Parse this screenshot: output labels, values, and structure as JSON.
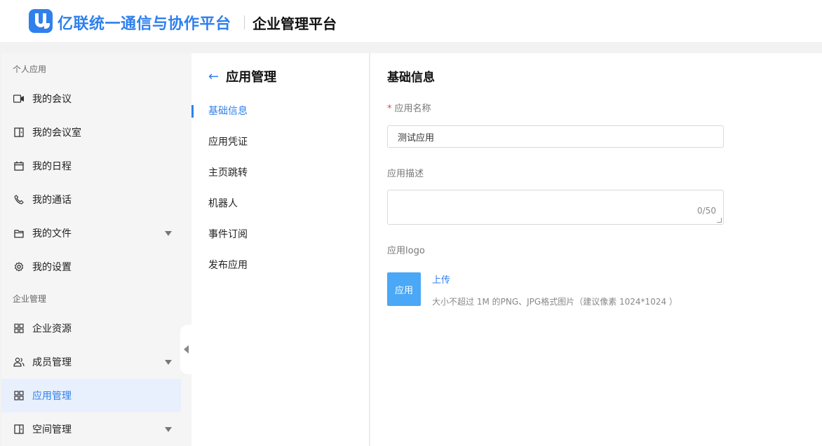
{
  "header": {
    "brand": "亿联统一通信与协作平台",
    "platform": "企业管理平台"
  },
  "sidebar": {
    "group_personal": "个人应用",
    "group_enterprise": "企业管理",
    "items": [
      {
        "label": "我的会议",
        "icon": "video-icon"
      },
      {
        "label": "我的会议室",
        "icon": "door-icon"
      },
      {
        "label": "我的日程",
        "icon": "calendar-icon"
      },
      {
        "label": "我的通话",
        "icon": "phone-icon"
      },
      {
        "label": "我的文件",
        "icon": "folder-icon"
      },
      {
        "label": "我的设置",
        "icon": "gear-icon"
      },
      {
        "label": "企业资源",
        "icon": "grid-icon"
      },
      {
        "label": "成员管理",
        "icon": "users-icon"
      },
      {
        "label": "应用管理",
        "icon": "grid-icon"
      },
      {
        "label": "空间管理",
        "icon": "door-icon"
      }
    ]
  },
  "mid": {
    "title": "应用管理",
    "menu": [
      "基础信息",
      "应用凭证",
      "主页跳转",
      "机器人",
      "事件订阅",
      "发布应用"
    ],
    "active_index": 0
  },
  "content": {
    "title": "基础信息",
    "name_label": "应用名称",
    "name_value": "测试应用",
    "desc_label": "应用描述",
    "desc_count": "0/50",
    "logo_label": "应用logo",
    "logo_text": "应用",
    "upload_label": "上传",
    "upload_hint": "大小不超过 1M 的PNG、JPG格式图片（建议像素 1024*1024 ）"
  },
  "colors": {
    "accent": "#2f80ed",
    "logo_bg": "#4aa8f6",
    "required": "#e64545"
  }
}
